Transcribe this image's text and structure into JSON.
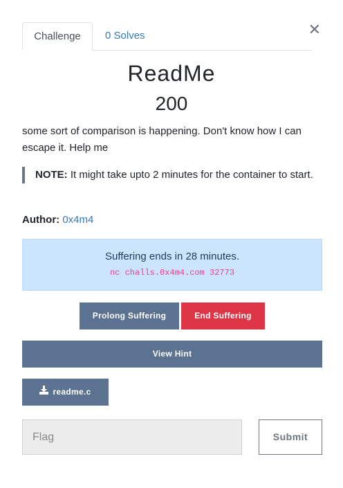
{
  "tabs": [
    {
      "label": "Challenge",
      "active": true
    },
    {
      "label": "0 Solves",
      "active": false
    }
  ],
  "close_icon": "close-icon",
  "challenge": {
    "title": "ReadMe",
    "value": "200",
    "description": "some sort of comparison is happening. Don't know how I can escape it. Help me",
    "note_label": "NOTE:",
    "note_text": "It might take upto 2 minutes for the container to start.",
    "author_label": "Author:",
    "author_name": "0x4m4"
  },
  "instance": {
    "message": "Suffering ends in 28 minutes.",
    "connection": "nc challs.0x4m4.com 32773"
  },
  "buttons": {
    "prolong": "Prolong Suffering",
    "end": "End Suffering",
    "hint": "View Hint",
    "file": "readme.c",
    "submit": "Submit"
  },
  "flag": {
    "placeholder": "Flag",
    "value": ""
  },
  "colors": {
    "primary": "#5b7290",
    "danger": "#dc3545",
    "info_bg": "#cce5ff",
    "link": "#337ab7"
  }
}
